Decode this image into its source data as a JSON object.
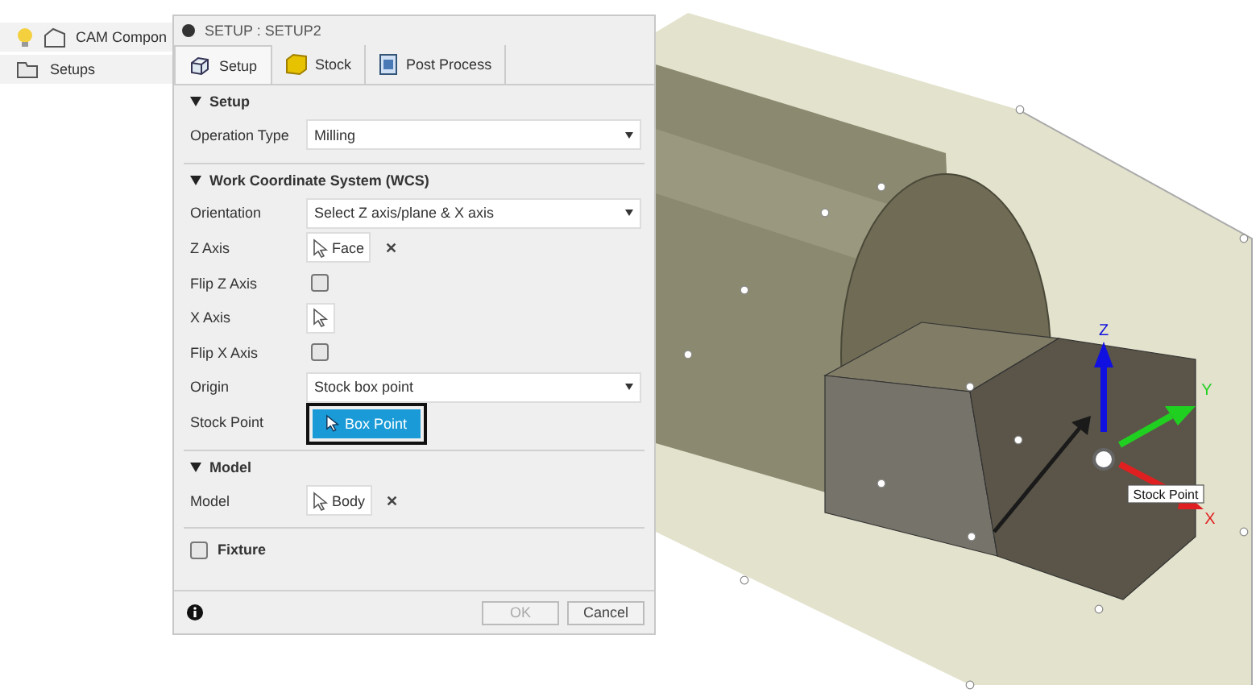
{
  "browser": {
    "items": [
      {
        "label": "CAM Compon",
        "kind": "component"
      },
      {
        "label": "Setups",
        "kind": "folder"
      }
    ]
  },
  "dialog": {
    "title": "SETUP : SETUP2",
    "tabs": [
      {
        "label": "Setup",
        "kind": "setup",
        "selected": true
      },
      {
        "label": "Stock",
        "kind": "stock",
        "selected": false
      },
      {
        "label": "Post Process",
        "kind": "post",
        "selected": false
      }
    ],
    "sections": [
      {
        "title": "Setup",
        "expanded": true,
        "rows": [
          {
            "label": "Operation Type",
            "kind": "select",
            "value": "Milling"
          }
        ]
      },
      {
        "title": "Work Coordinate System (WCS)",
        "expanded": true,
        "rows": [
          {
            "label": "Orientation",
            "kind": "select",
            "value": "Select Z axis/plane & X axis"
          },
          {
            "label": "Z Axis",
            "kind": "selection",
            "value": "Face",
            "clear": "✕"
          },
          {
            "label": "Flip Z Axis",
            "kind": "checkbox",
            "checked": false
          },
          {
            "label": "X Axis",
            "kind": "selection"
          },
          {
            "label": "Flip X Axis",
            "kind": "checkbox",
            "checked": false
          },
          {
            "label": "Origin",
            "kind": "select",
            "value": "Stock box point"
          },
          {
            "label": "Stock Point",
            "kind": "button",
            "value": "Box Point",
            "highlighted": true
          }
        ]
      },
      {
        "title": "Model",
        "expanded": true,
        "rows": [
          {
            "label": "Model",
            "kind": "selection",
            "value": "Body",
            "clear": "✕"
          }
        ]
      }
    ],
    "fixture": {
      "label": "Fixture",
      "checked": false
    },
    "buttons": [
      {
        "label": "OK",
        "disabled": true
      },
      {
        "label": "Cancel",
        "disabled": false
      }
    ]
  },
  "viewport": {
    "axes": [
      {
        "label": "Z",
        "color": "#1010e0"
      },
      {
        "label": "Y",
        "color": "#20d020"
      },
      {
        "label": "X",
        "color": "#e02020"
      }
    ],
    "tooltip": "Stock Point"
  }
}
